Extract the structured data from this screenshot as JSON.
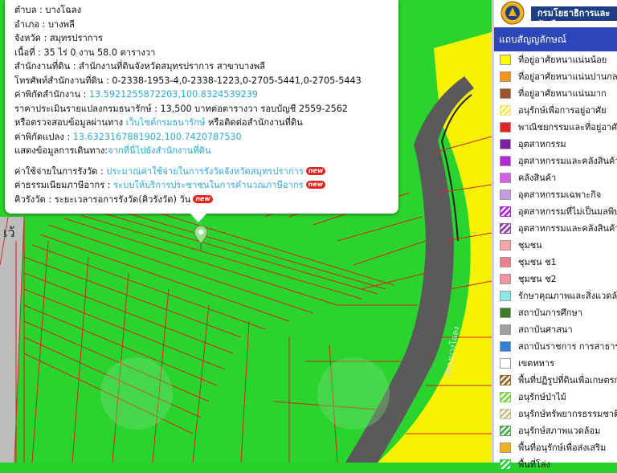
{
  "popup": {
    "rows": [
      {
        "label": "ตำบล :",
        "value": "บางโฉลง"
      },
      {
        "label": "อำเภอ :",
        "value": "บางพลี"
      },
      {
        "label": "จังหวัด :",
        "value": "สมุทรปราการ"
      },
      {
        "label": "เนื้อที่ :",
        "value": "35 ไร่ 0 งาน 58.0 ตารางวา"
      },
      {
        "label": "สำนักงานที่ดิน :",
        "value": "สำนักงานที่ดินจังหวัดสมุทรปราการ สาขาบางพลี"
      },
      {
        "label": "โทรศัพท์สำนักงานที่ดิน :",
        "value": "0-2338-1953-4,0-2338-1223,0-2705-5441,0-2705-5443"
      }
    ],
    "office_coord_label": "ค่าพิกัดสำนักงาน :",
    "office_coord_value": "13.5921255872203,100.8324539239",
    "price_label": "ราคาประเมินรายแปลงกรมธนารักษ์ :",
    "price_value": "13,500 บาทต่อตารางวา รอบบัญชี 2559-2562",
    "verify_prefix": "หรือตรวจสอบข้อมูลผ่านทาง",
    "verify_link": "เว็บไซต์กรมธนารักษ์",
    "verify_suffix": "หรือติดต่อสำนักงานที่ดิน",
    "parcel_coord_label": "ค่าพิกัดแปลง :",
    "parcel_coord_value": "13.6323167881902,100.7420787530",
    "route_label": "แสดงข้อมูลการเดินทาง:",
    "route_link": "จากที่นี่ไปยังสำนักงานที่ดิน",
    "fee_label": "ค่าใช้จ่ายในการรังวัด :",
    "fee_link": "ประมาณค่าใช้จ่ายในการรังวัดจังหวัดสมุทรปราการ",
    "tax_label": "ค่าธรรมเนียมภาษีอากร :",
    "tax_link": "ระบบให้บริการประชาชนในการคำนวณภาษีอากร",
    "queue_label": "คิวรังวัด :",
    "queue_value": "ระยะเวลารอการรังวัด(คิวรังวัด) วัน",
    "badge": "new"
  },
  "map": {
    "canal_label": "คลองบางโฉลง",
    "road_label": "เว้"
  },
  "legend": {
    "department": "กรมโยธาธิการและผังเมือง",
    "title": "แถบสัญญลักษณ์",
    "items": [
      {
        "label": "ที่อยู่อาศัยหนาแน่นน้อย",
        "color": "#fdfd02",
        "pattern": "solid"
      },
      {
        "label": "ที่อยู่อาศัยหนาแน่นปานกลาง",
        "color": "#f7941d",
        "pattern": "solid"
      },
      {
        "label": "ที่อยู่อาศัยหนาแน่นมาก",
        "color": "#a0522d",
        "pattern": "solid"
      },
      {
        "label": "อนุรักษ์เพื่อการอยู่อาศัย",
        "color": "#f5e663",
        "pattern": "hatch"
      },
      {
        "label": "พาณิชยกรรมและที่อยู่อาศัย",
        "color": "#e8231d",
        "pattern": "solid"
      },
      {
        "label": "อุตสาหกรรม",
        "color": "#7b1fa2",
        "pattern": "solid"
      },
      {
        "label": "อุตสาหกรรมและคลังสินค้า",
        "color": "#b428d8",
        "pattern": "solid"
      },
      {
        "label": "คลังสินค้า",
        "color": "#d65fe8",
        "pattern": "solid"
      },
      {
        "label": "อุตสาหกรรมเฉพาะกิจ",
        "color": "#c39be0",
        "pattern": "solid"
      },
      {
        "label": "อุตสาหกรรมที่ไม่เป็นมลพิษ",
        "color": "#b428d8",
        "pattern": "hatch"
      },
      {
        "label": "อุตสาหกรรมและคลังสินค้า",
        "color": "#8e44ad",
        "pattern": "hatch"
      },
      {
        "label": "ชุมชน",
        "color": "#f7a6a6",
        "pattern": "solid"
      },
      {
        "label": "ชุมชน ช1",
        "color": "#ec7f8b",
        "pattern": "solid"
      },
      {
        "label": "ชุมชน ช2",
        "color": "#f2939f",
        "pattern": "solid"
      },
      {
        "label": "รักษาคุณภาพและสิ่งแวดล้อม",
        "color": "#8ce6ea",
        "pattern": "solid"
      },
      {
        "label": "สถาบันการศึกษา",
        "color": "#3e7d2b",
        "pattern": "solid"
      },
      {
        "label": "สถาบันศาสนา",
        "color": "#a0a0a0",
        "pattern": "solid"
      },
      {
        "label": "สถาบันราชการ การสาธารณูปโภค",
        "color": "#2f80d6",
        "pattern": "solid"
      },
      {
        "label": "เขตทหาร",
        "color": "#ffffff",
        "pattern": "solid"
      },
      {
        "label": "พื้นที่ปฏิรูปที่ดินเพื่อเกษตรกรรม",
        "color": "#9b6a2f",
        "pattern": "hatch"
      },
      {
        "label": "อนุรักษ์ป่าไม้",
        "color": "#7fd64d",
        "pattern": "hatch"
      },
      {
        "label": "อนุรักษ์ทรัพยากรธรรมชาติ",
        "color": "#c8c090",
        "pattern": "hatch"
      },
      {
        "label": "อนุรักษ์สภาพแวดล้อม",
        "color": "#4caf50",
        "pattern": "hatch"
      },
      {
        "label": "พื้นที่อนุรักษ์เพื่อส่งเสริม",
        "color": "#f2b21a",
        "pattern": "solid"
      },
      {
        "label": "พื้นที่โล่ง",
        "color": "#2ecc40",
        "pattern": "hatch"
      }
    ]
  }
}
